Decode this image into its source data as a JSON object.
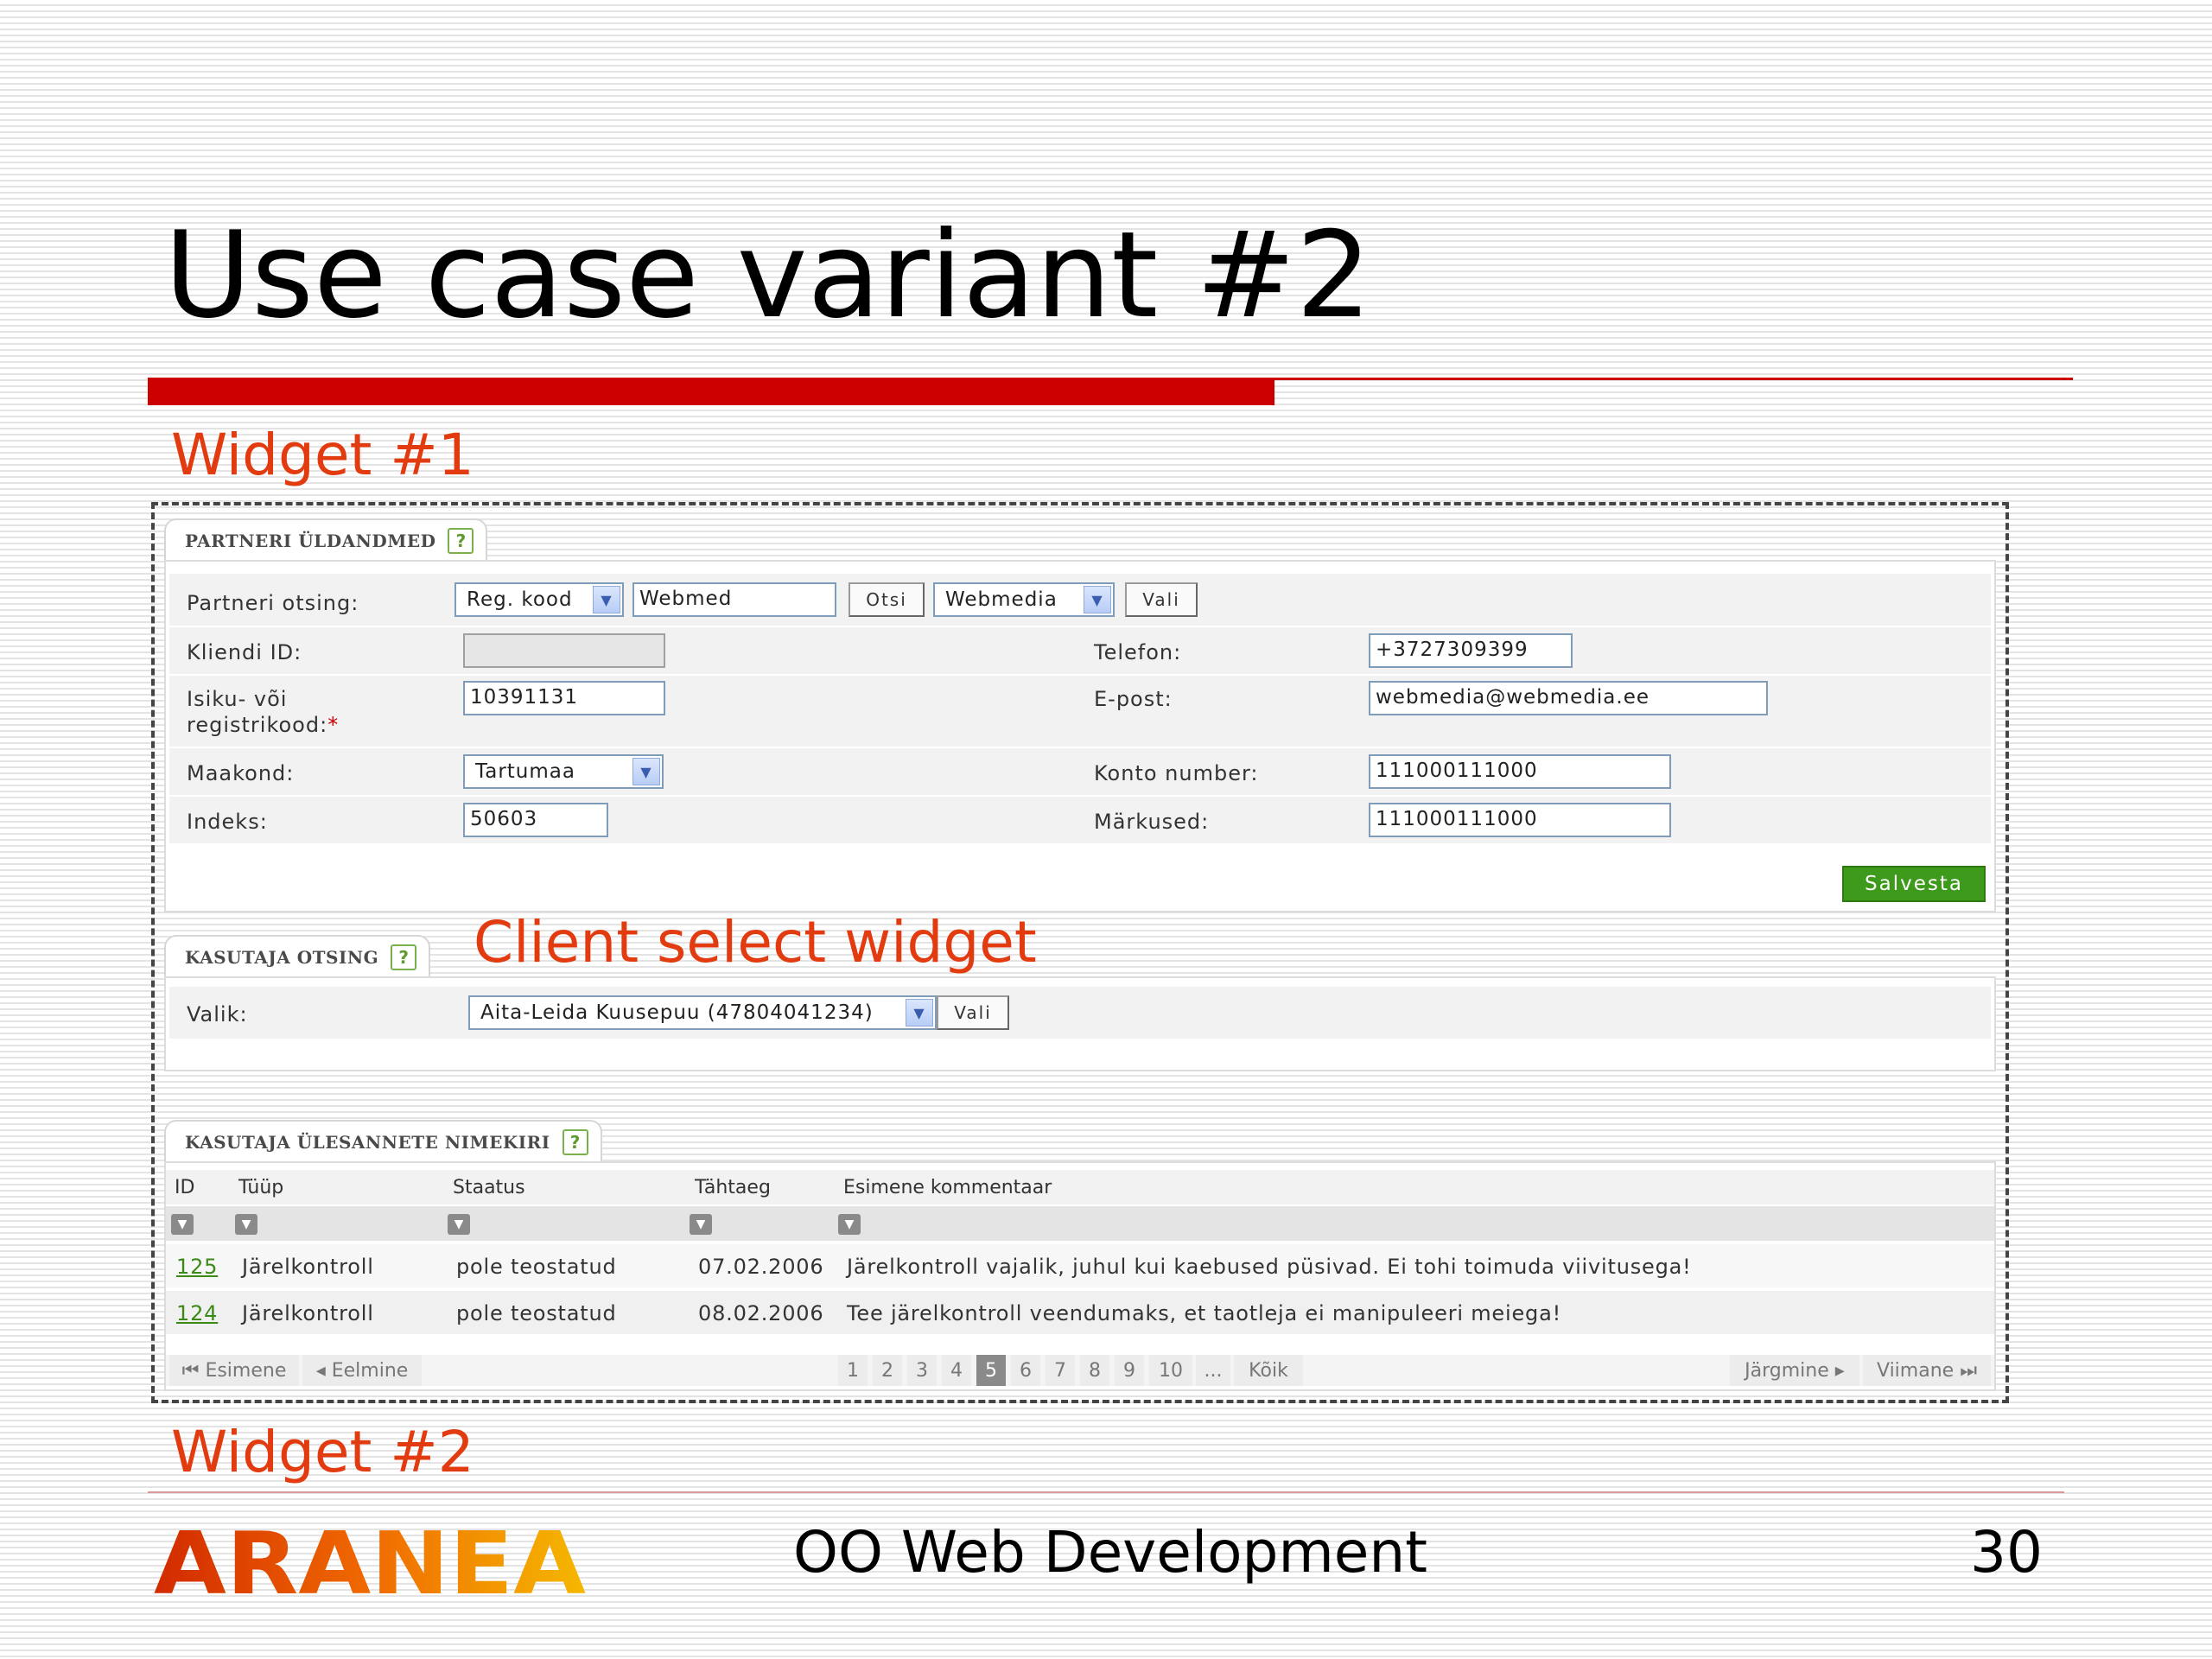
{
  "slide": {
    "title": "Use case variant #2",
    "widget1_label": "Widget #1",
    "widget2_label": "Widget #2",
    "client_select_label": "Client select widget",
    "footer_title": "OO Web Development",
    "page_number": "30",
    "logo_text": "ARANEA"
  },
  "partner_panel": {
    "tab_label": "PARTNERI ÜLDANDMED",
    "help": "?",
    "search_label": "Partneri otsing:",
    "search_type": "Reg. kood",
    "search_input": "Webmed",
    "search_button": "Otsi",
    "result_select": "Webmedia",
    "select_button": "Vali",
    "client_id_label": "Kliendi ID:",
    "client_id_value": "",
    "id_code_label_1": "Isiku- või",
    "id_code_label_2": "registrikood:",
    "required_mark": "*",
    "id_code_value": "10391131",
    "county_label": "Maakond:",
    "county_value": "Tartumaa",
    "index_label": "Indeks:",
    "index_value": "50603",
    "phone_label": "Telefon:",
    "phone_value": "+3727309399",
    "email_label": "E-post:",
    "email_value": "webmedia@webmedia.ee",
    "account_label": "Konto number:",
    "account_value": "111000111000",
    "notes_label": "Märkused:",
    "notes_value": "111000111000",
    "save_button": "Salvesta"
  },
  "user_search_panel": {
    "tab_label": "KASUTAJA OTSING",
    "help": "?",
    "choice_label": "Valik:",
    "choice_value": "Aita-Leida Kuusepuu (47804041234)",
    "select_button": "Vali"
  },
  "task_list_panel": {
    "tab_label": "KASUTAJA ÜLESANNETE NIMEKIRI",
    "help": "?",
    "columns": [
      "ID",
      "Tüüp",
      "Staatus",
      "Tähtaeg",
      "Esimene kommentaar"
    ],
    "rows": [
      {
        "id": "125",
        "type": "Järelkontroll",
        "status": "pole teostatud",
        "deadline": "07.02.2006",
        "comment": "Järelkontroll vajalik, juhul kui kaebused püsivad. Ei tohi toimuda viivitusega!"
      },
      {
        "id": "124",
        "type": "Järelkontroll",
        "status": "pole teostatud",
        "deadline": "08.02.2006",
        "comment": "Tee järelkontroll veendumaks, et taotleja ei manipuleeri meiega!"
      }
    ],
    "pagination": {
      "first": "Esimene",
      "prev": "Eelmine",
      "pages": [
        "1",
        "2",
        "3",
        "4",
        "5",
        "6",
        "7",
        "8",
        "9",
        "10"
      ],
      "active_page": "5",
      "ellipsis": "...",
      "all": "Kõik",
      "next": "Järgmine",
      "last": "Viimane"
    }
  },
  "colors": {
    "accent_red": "#cc0000",
    "label_orange": "#e33b10",
    "save_green": "#3d9a1a",
    "link_green": "#3b8a18"
  }
}
